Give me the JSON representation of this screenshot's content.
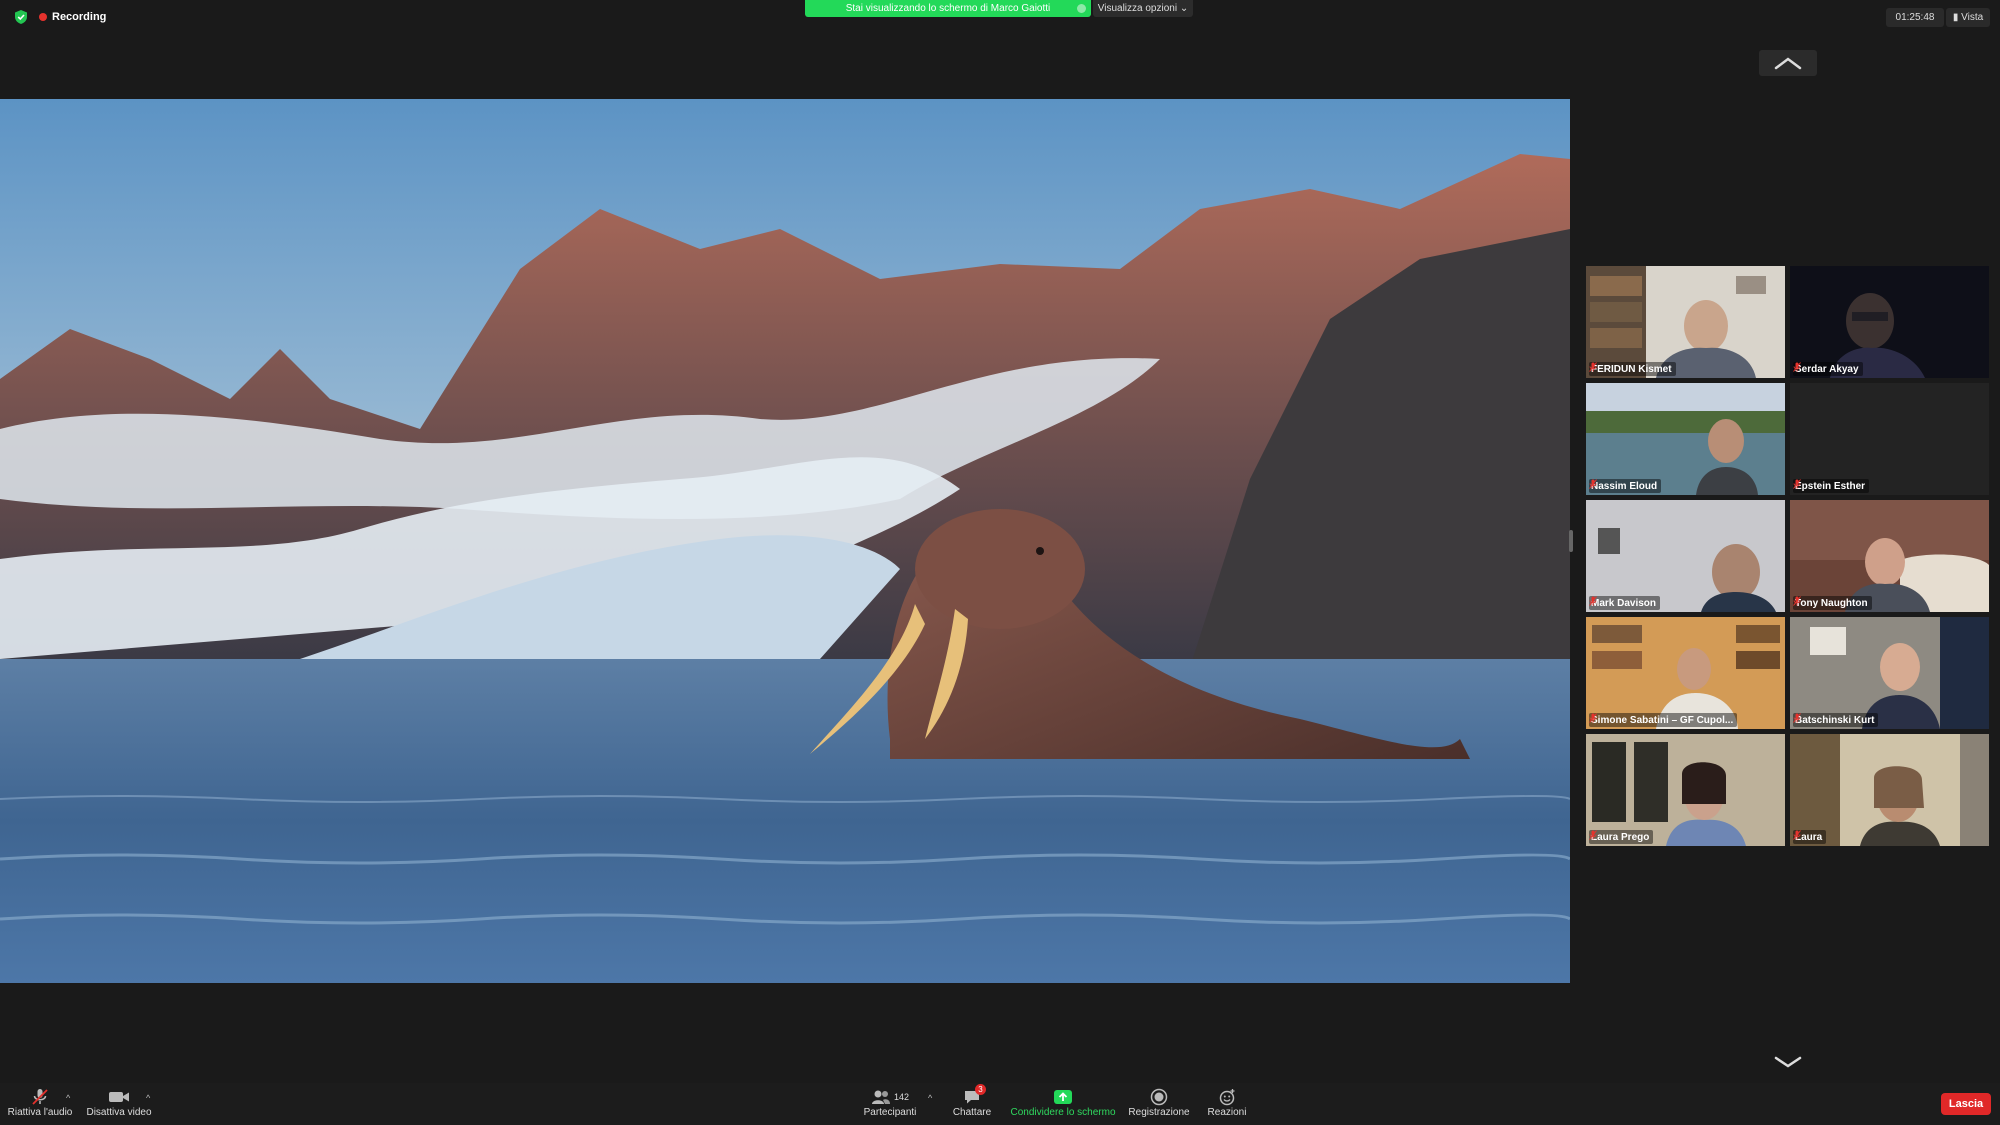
{
  "topbar": {
    "recording_label": "Recording",
    "share_banner": "Stai visualizzando lo schermo di Marco Gaiotti",
    "view_options": "Visualizza opzioni",
    "timer": "01:25:48",
    "view_label": "Vista"
  },
  "participants_gallery": [
    {
      "name": "FERIDUN Kismet",
      "muted": true
    },
    {
      "name": "Serdar Akyay",
      "muted": true
    },
    {
      "name": "Nassim Eloud",
      "muted": true
    },
    {
      "name": "Epstein Esther",
      "muted": true
    },
    {
      "name": "Mark Davison",
      "muted": true
    },
    {
      "name": "Tony Naughton",
      "muted": true
    },
    {
      "name": "Simone Sabatini – GF Cupol...",
      "muted": true
    },
    {
      "name": "Batschinski Kurt",
      "muted": true
    },
    {
      "name": "Laura Prego",
      "muted": true
    },
    {
      "name": "Laura",
      "muted": true
    }
  ],
  "toolbar": {
    "audio_label": "Riattiva l'audio",
    "video_label": "Disattiva video",
    "participants_label": "Partecipanti",
    "participants_count": "142",
    "chat_label": "Chattare",
    "chat_badge": "3",
    "share_label": "Condividere lo schermo",
    "record_label": "Registrazione",
    "reactions_label": "Reazioni",
    "leave_label": "Lascia"
  },
  "colors": {
    "share_green": "#23d959",
    "record_red": "#e5322d",
    "leave_red": "#e02828",
    "background": "#1a1a1a"
  },
  "icons": [
    "shield-icon",
    "record-dot-icon",
    "chevron-up-icon",
    "chevron-down-icon",
    "mic-muted-icon",
    "video-icon",
    "participants-icon",
    "chat-icon",
    "share-screen-icon",
    "record-icon",
    "reactions-icon"
  ]
}
